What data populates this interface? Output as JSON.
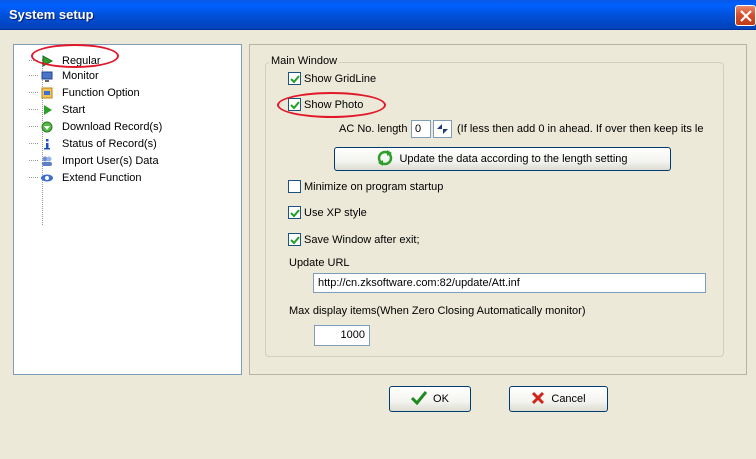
{
  "window": {
    "title": "System setup",
    "close_label": "×"
  },
  "tree": {
    "items": [
      {
        "label": "Regular",
        "icon": "play-arrow-green-icon"
      },
      {
        "label": "Monitor",
        "icon": "monitor-icon"
      },
      {
        "label": "Function Option",
        "icon": "function-option-icon"
      },
      {
        "label": "Start",
        "icon": "play-arrow-green-icon"
      },
      {
        "label": "Download Record(s)",
        "icon": "download-arrow-icon"
      },
      {
        "label": "Status of Record(s)",
        "icon": "info-icon"
      },
      {
        "label": "Import User(s) Data",
        "icon": "users-import-icon"
      },
      {
        "label": "Extend Function",
        "icon": "extend-function-icon"
      }
    ]
  },
  "main_window": {
    "group_label": "Main Window",
    "show_gridline": {
      "label": "Show GridLine",
      "checked": true
    },
    "show_photo": {
      "label": "Show Photo",
      "checked": true
    },
    "ac_no_length_label": "AC No. length",
    "ac_no_length_value": "0",
    "ac_no_length_hint": "(If less then add 0 in ahead. If over then keep its le",
    "update_button_label": "Update the data according to the length setting",
    "minimize_startup": {
      "label": "Minimize on program startup",
      "checked": false
    },
    "use_xp_style": {
      "label": "Use XP style",
      "checked": true
    },
    "save_window": {
      "label": "Save Window after exit;",
      "checked": true
    },
    "update_url_label": "Update URL",
    "update_url_value": "http://cn.zksoftware.com:82/update/Att.inf",
    "max_display_label": "Max display items(When Zero Closing Automatically monitor)",
    "max_display_value": "1000"
  },
  "footer": {
    "ok_label": "OK",
    "cancel_label": "Cancel"
  },
  "colors": {
    "titlebar": "#0055E5",
    "highlight_ellipse": "#E0182A",
    "dialog_bg": "#ECE9D8"
  }
}
